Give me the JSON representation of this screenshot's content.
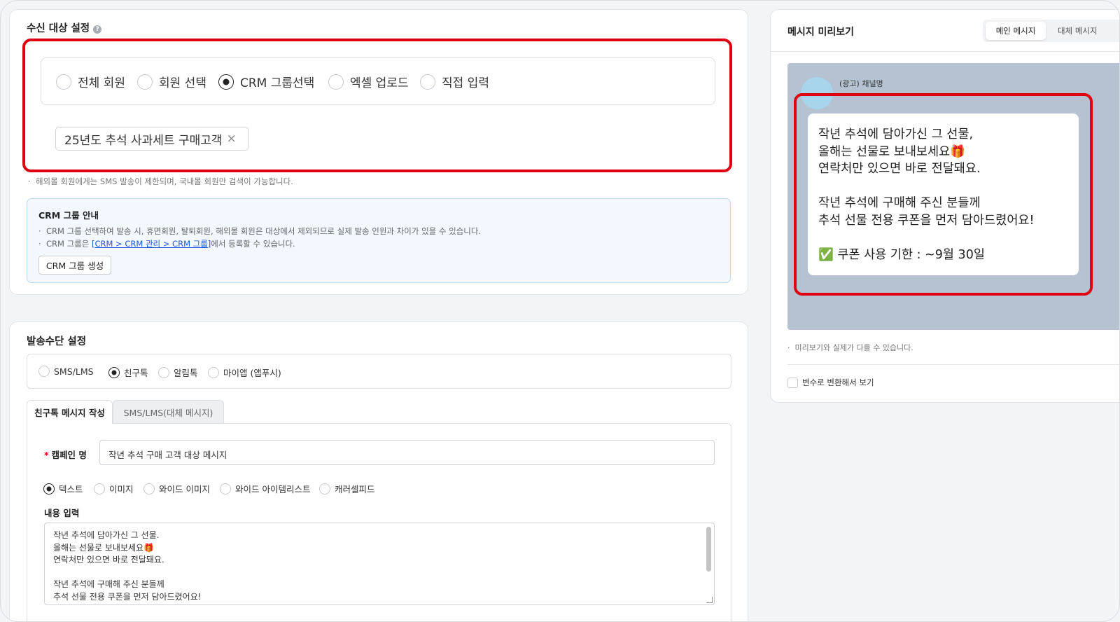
{
  "recipient": {
    "title": "수신 대상 설정",
    "help": "?",
    "options": [
      "전체 회원",
      "회원 선택",
      "CRM 그룹선택",
      "엑셀 업로드",
      "직접 입력"
    ],
    "selected_index": 2,
    "chip": "25년도 추석 사과세트 구매고객",
    "chip_remove": "×",
    "note": "해외몰 회원에게는 SMS 발송이 제한되며, 국내몰 회원만 검색이 가능합니다.",
    "crm_info": {
      "title": "CRM 그룹 안내",
      "line1": "CRM 그룹 선택하여 발송 시, 휴면회원, 탈퇴회원, 해외몰 회원은 대상에서 제외되므로 실제 발송 인원과 차이가 있을 수 있습니다.",
      "line2_prefix": "CRM 그룹은 ",
      "line2_link": "[CRM > CRM 관리 > CRM 그룹]",
      "line2_suffix": "에서 등록할 수 있습니다.",
      "create_button": "CRM 그룹 생성"
    }
  },
  "send_method": {
    "title": "발송수단 설정",
    "options": [
      "SMS/LMS",
      "친구톡",
      "알림톡",
      "마이앱 (앱푸시)"
    ],
    "selected_index": 1,
    "tabs": [
      "친구톡 메시지 작성",
      "SMS/LMS(대체 메시지)"
    ],
    "active_tab": 0,
    "campaign_label": "캠페인 명",
    "required_mark": "*",
    "campaign_value": "작년 추석 구매 고객 대상 메시지",
    "msg_types": [
      "텍스트",
      "이미지",
      "와이드 이미지",
      "와이드 아이템리스트",
      "캐러셀피드"
    ],
    "msg_type_selected": 0,
    "content_label": "내용 입력",
    "content_lines": [
      "작년 추석에 담아가신 그 선물.",
      "올해는 선물로 보내보세요🎁",
      "연락처만 있으면 바로 전달돼요.",
      "",
      "작년 추석에 구매해 주신 분들께",
      "추석 선물 전용 쿠폰을 먼저 담아드렸어요!"
    ]
  },
  "preview": {
    "title": "메시지 미리보기",
    "tabs": [
      "메인 메시지",
      "대체 메시지"
    ],
    "active_tab": 0,
    "channel": "(광고) 채널명",
    "bubble_lines": [
      "작년 추석에 담아가신 그 선물,",
      "올해는 선물로 보내보세요🎁",
      "연락처만 있으면 바로 전달돼요.",
      "",
      "작년 추석에 구매해 주신 분들께",
      "추석 선물 전용 쿠폰을 먼저 담아드렸어요!",
      "",
      "✅ 쿠폰 사용 기한 : ~9월 30일"
    ],
    "note": "미리보기와 실제가 다를 수 있습니다.",
    "variable_checkbox": "변수로 변환해서 보기"
  },
  "colors": {
    "highlight": "#e00012",
    "link": "#1f55d6",
    "required": "#e00012",
    "preview_bg": "#b4c2d2"
  }
}
